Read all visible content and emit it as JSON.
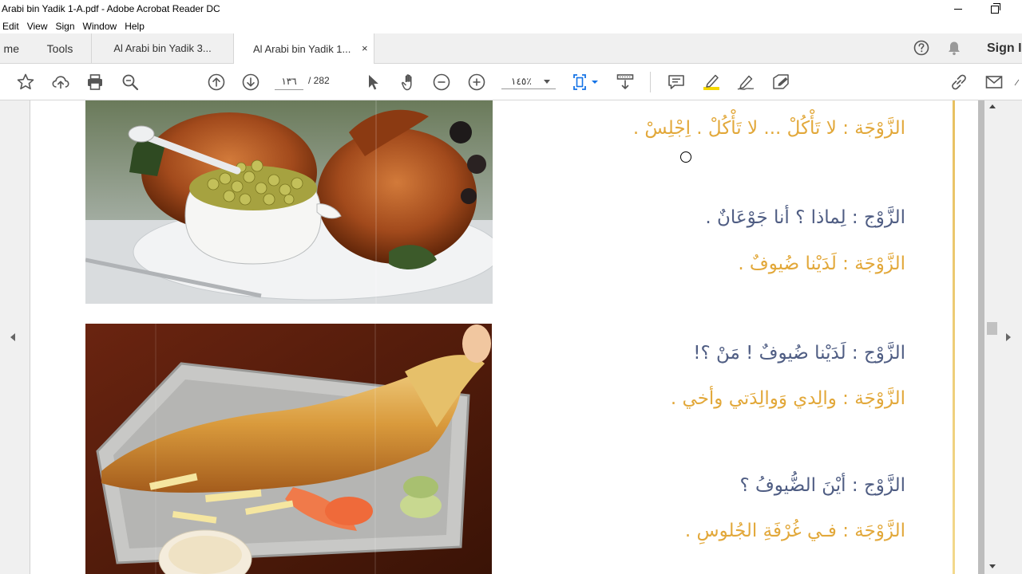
{
  "window": {
    "title": "Arabi bin Yadik 1-A.pdf - Adobe Acrobat Reader DC"
  },
  "menu": [
    "Edit",
    "View",
    "Sign",
    "Window",
    "Help"
  ],
  "tabs": {
    "home": "me",
    "tools": "Tools",
    "doc1": "Al Arabi bin Yadik 3...",
    "doc2": "Al Arabi bin Yadik 1...",
    "close": "×"
  },
  "account": {
    "sign_in": "Sign In"
  },
  "toolbar": {
    "page_current": "١٣٦",
    "page_total": "/  282",
    "zoom": "١٤٥٪"
  },
  "document": {
    "dialogue": [
      {
        "speaker": "wife",
        "text": "الزَّوْجَة : لا تَأْكُلْ ... لا تَأْكُلْ . اِجْلِسْ ."
      },
      {
        "speaker": "husband",
        "text": "الزَّوْج : لِماذا ؟ أنا جَوْعَانٌ ."
      },
      {
        "speaker": "wife",
        "text": "الزَّوْجَة : لَدَيْنا ضُيوفٌ ."
      },
      {
        "speaker": "husband",
        "text": "الزَّوْج : لَدَيْنا ضُيوفٌ ! مَنْ ؟!"
      },
      {
        "speaker": "wife",
        "text": "الزَّوْجَة : والِدي وَوالِدَتي وأخي ."
      },
      {
        "speaker": "husband",
        "text": "الزَّوْج : أيْنَ الضُّيوفُ ؟"
      },
      {
        "speaker": "wife",
        "text": "الزَّوْجَة : فـي غُرْفَةِ الجُلوسِ ."
      }
    ]
  },
  "colors": {
    "wife_text": "#e2a83a",
    "husband_text": "#4f5d83",
    "toolbar_accent": "#1473e6",
    "highlight": "#f5d800"
  },
  "icons": [
    "star-icon",
    "cloud-upload-icon",
    "print-icon",
    "zoom-magnifier-icon",
    "page-up-icon",
    "page-down-icon",
    "select-cursor-icon",
    "hand-tool-icon",
    "zoom-out-icon",
    "zoom-in-icon",
    "fit-page-icon",
    "scroll-mode-icon",
    "comment-icon",
    "highlight-icon",
    "sign-pen-icon",
    "fill-sign-icon",
    "share-link-icon",
    "email-icon",
    "help-icon",
    "bell-icon"
  ]
}
